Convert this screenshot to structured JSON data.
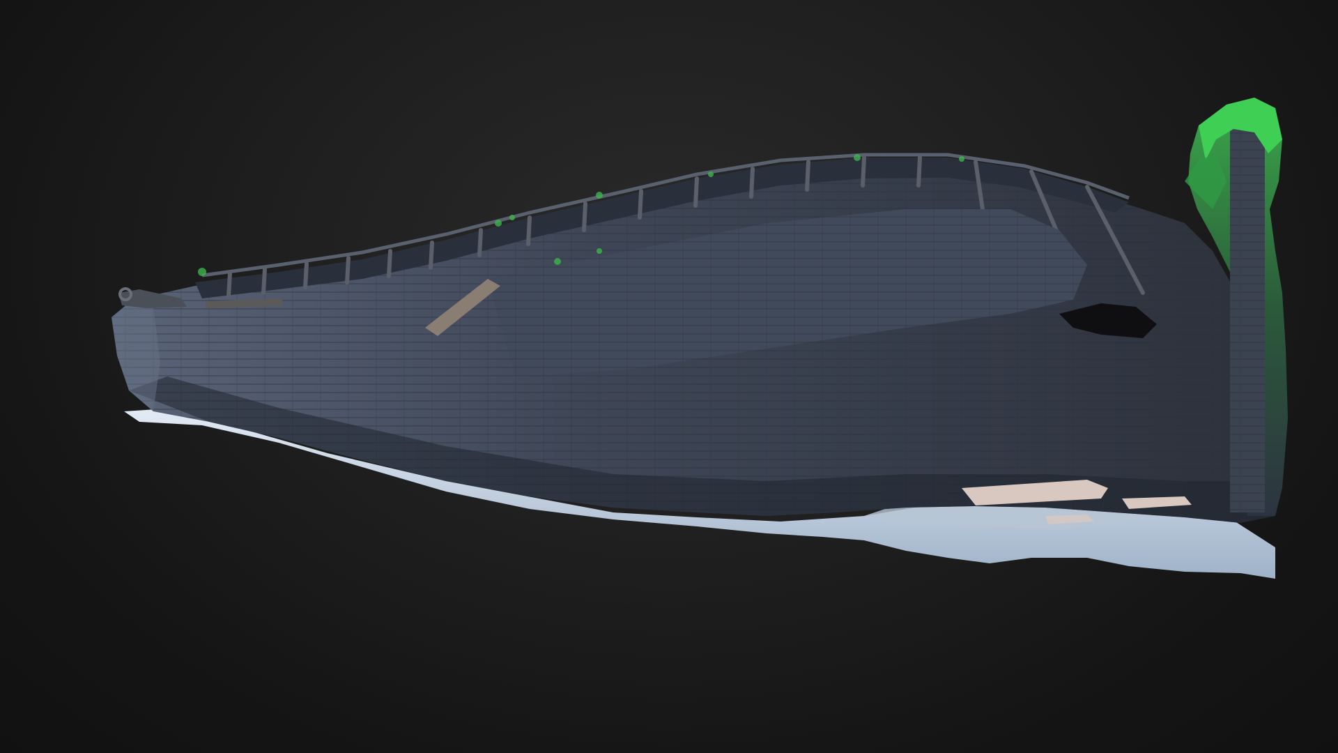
{
  "scene": {
    "subject": "shipwreck-3d-model",
    "background_color": "#1c1c1c",
    "hull_color": "#3d4656",
    "seabed_color": "#c9d3df",
    "growth_color": "#3fbf52"
  }
}
